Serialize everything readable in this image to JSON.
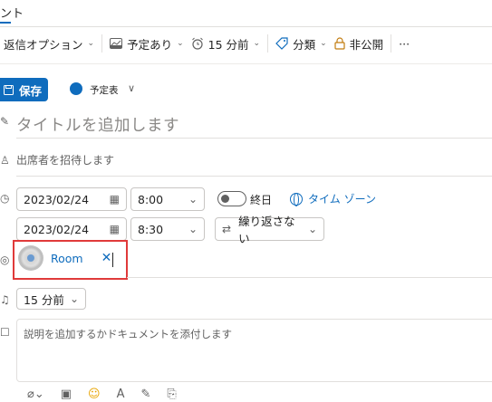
{
  "tab": {
    "title": "ント"
  },
  "toolbar": {
    "reply_options": "返信オプション",
    "busy_status": "予定あり",
    "reminder": "15 分前",
    "category": "分類",
    "private": "非公開",
    "more": "···"
  },
  "actions": {
    "save_label": "保存"
  },
  "calendar": {
    "name": "予定表",
    "color": "#0f6cbd"
  },
  "form": {
    "title_placeholder": "タイトルを追加します",
    "attendees_placeholder": "出席者を招待します",
    "start_date": "2023/02/24",
    "start_time": "8:00",
    "end_date": "2023/02/24",
    "end_time": "8:30",
    "all_day_label": "終日",
    "time_zone_label": "タイム ゾーン",
    "repeat_label": "繰り返さない",
    "room_name": "Room",
    "reminder_value": "15 分前",
    "description_placeholder": "説明を追加するかドキュメントを添付します"
  },
  "colors": {
    "accent": "#0f6cbd",
    "highlight_box": "#e03a3a"
  }
}
